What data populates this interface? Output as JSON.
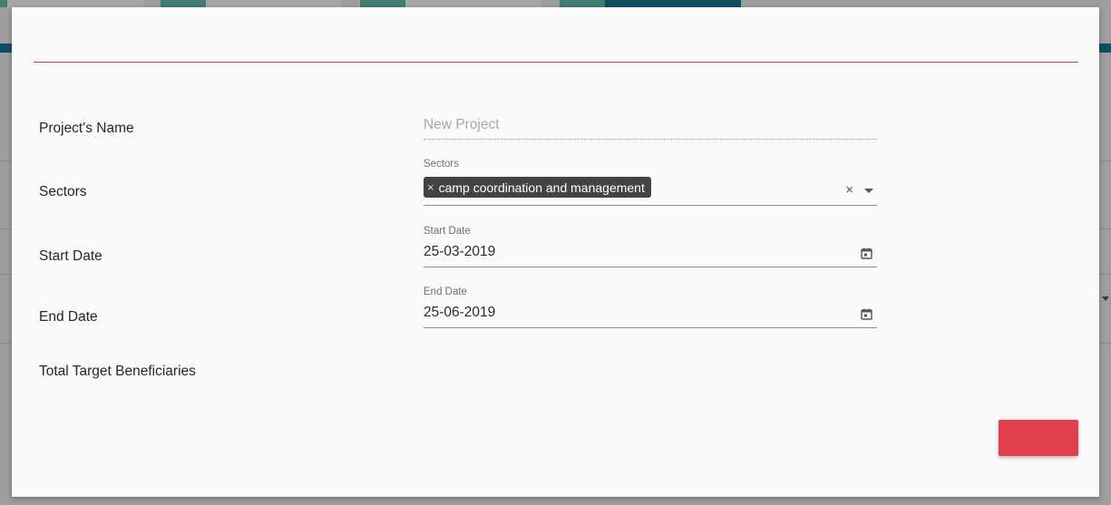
{
  "form": {
    "project_name": {
      "label": "Project's Name",
      "placeholder": "New Project",
      "value": ""
    },
    "sectors": {
      "label": "Sectors",
      "float_label": "Sectors",
      "chips": [
        "camp coordination and management"
      ],
      "clear_glyph": "×"
    },
    "start_date": {
      "label": "Start Date",
      "float_label": "Start Date",
      "value": "25-03-2019"
    },
    "end_date": {
      "label": "End Date",
      "float_label": "End Date",
      "value": "25-06-2019"
    },
    "total_target_beneficiaries": {
      "label": "Total Target Beneficiaries"
    }
  },
  "icons": {
    "chip_remove": "close-icon",
    "clear": "close-icon",
    "dropdown": "chevron-down-icon",
    "calendar": "calendar-icon"
  },
  "colors": {
    "accent_red": "#e03f4b",
    "modal_rule": "#d8394a",
    "chip_bg": "#434343",
    "bg_teal": "#0e4f60",
    "bg_green": "#3f7e6e"
  }
}
